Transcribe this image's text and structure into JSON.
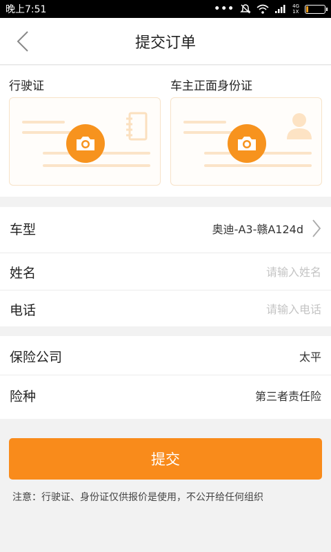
{
  "status_bar": {
    "time": "晚上7:51",
    "dots": "•••",
    "network_top": "4G",
    "network_bottom": "1X",
    "battery_level": 0.05,
    "battery_color": "#f0a020"
  },
  "header": {
    "title": "提交订单",
    "back_icon": "chevron-left-icon"
  },
  "photos": [
    {
      "label": "行驶证",
      "icon": "camera-icon",
      "decor": "notebook-icon"
    },
    {
      "label": "车主正面身份证",
      "icon": "camera-icon",
      "decor": "person-icon"
    }
  ],
  "form": {
    "car_model": {
      "label": "车型",
      "value": "奥迪-A3-赣A124d"
    },
    "name": {
      "label": "姓名",
      "placeholder": "请输入姓名",
      "value": ""
    },
    "phone": {
      "label": "电话",
      "placeholder": "请输入电话",
      "value": ""
    }
  },
  "insurance": {
    "company": {
      "label": "保险公司",
      "value": "太平"
    },
    "type": {
      "label": "险种",
      "value": "第三者责任险"
    }
  },
  "submit_label": "提交",
  "notice": "注意：行驶证、身份证仅供报价是使用，不公开给任何组织",
  "colors": {
    "accent": "#f98b1b",
    "camera": "#f7931e",
    "card_lines": "#fbe4c8"
  }
}
